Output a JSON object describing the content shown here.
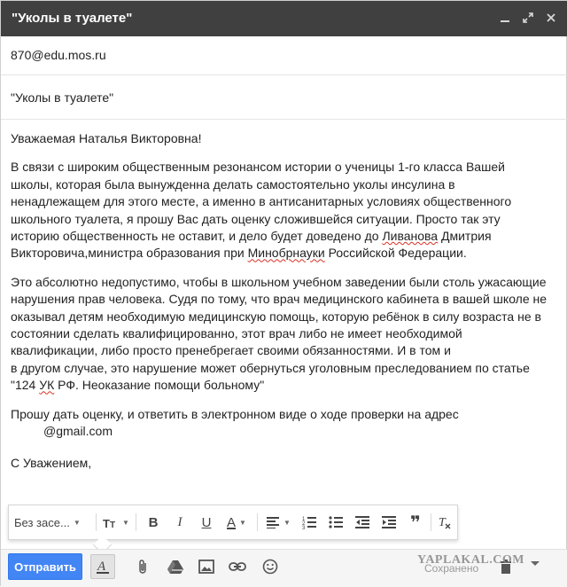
{
  "window": {
    "title": "\"Уколы в туалете\""
  },
  "compose": {
    "to": "870@edu.mos.ru",
    "subject": "\"Уколы в туалете\""
  },
  "body": {
    "greeting": "Уважаемая Наталья Викторовна!",
    "p1": [
      "В связи с широким общественным резонансом истории о ученицы 1-го класса Вашей",
      "школы, которая была вынужденна делать самостоятельно уколы инсулина в",
      "ненадлежащем для этого месте, а именно в антисанитарных условиях общественного",
      "школьного туалета, я прошу Вас дать оценку сложившейся ситуации. Просто так эту",
      "историю общественность не оставит, и дело будет доведено до ",
      "Ливанова",
      " Дмитрия",
      "Викторовича,министра образования при ",
      "Минобрнауки",
      " Российской Федерации."
    ],
    "p2": [
      "Это абсолютно недопустимо, чтобы в школьном учебном заведении были столь ужасающие",
      "нарушения прав человека. Судя по тому, что врач медицинского кабинета в вашей школе не",
      "оказывал детям необходимую медицинскую помощь, которую ребёнок в силу возраста не в",
      "состоянии сделать квалифицированно, этот врач либо не имеет необходимой",
      "квалификации, либо просто пренебрегает своими обязанностями. И в том и",
      "в другом случае, это нарушение может обернуться уголовным преследованием по статье",
      "\"124 ",
      "УК",
      " РФ. Неоказание помощи больному\""
    ],
    "p3": [
      "Прошу дать оценку, и ответить в электронном виде о ходе проверки на адрес",
      "@gmail.com"
    ],
    "closing": "С Уважением,"
  },
  "format_toolbar": {
    "font_label": "Без засе...",
    "size_icon": "text-size-icon",
    "bold": "B",
    "italic": "I",
    "underline": "U",
    "text_color": "A",
    "align_icon": "align-icon",
    "numbered_icon": "numbered-list-icon",
    "bulleted_icon": "bulleted-list-icon",
    "indent_less_icon": "indent-less-icon",
    "indent_more_icon": "indent-more-icon",
    "quote": "❞",
    "clear_format_icon": "clear-format-icon"
  },
  "bottom_bar": {
    "send_label": "Отправить",
    "saved_label": "Сохранено"
  },
  "watermark": "YAPLAKAL.COM",
  "colors": {
    "titlebar": "#404040",
    "send_button": "#4285f4",
    "spellcheck": "#d93025"
  }
}
